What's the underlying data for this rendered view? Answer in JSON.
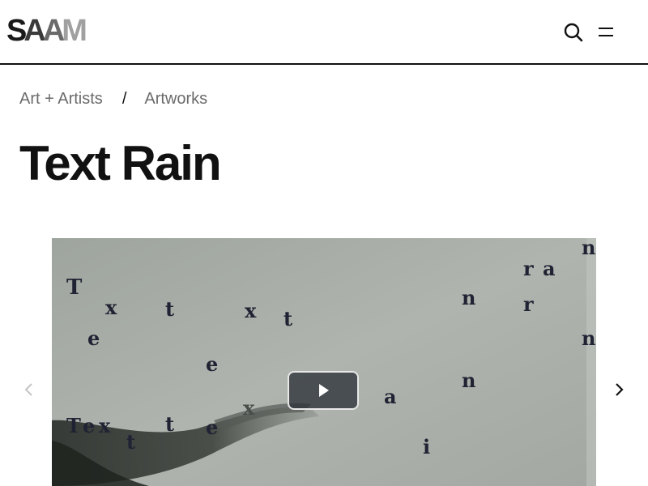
{
  "header": {
    "logo_text": "SAAM",
    "logo_letters": [
      "S",
      "A",
      "A",
      "M"
    ],
    "search_icon": "search-icon",
    "menu_icon": "hamburger-menu-icon"
  },
  "breadcrumb": {
    "items": [
      "Art + Artists",
      "Artworks"
    ],
    "separator": "/"
  },
  "page": {
    "title": "Text Rain"
  },
  "carousel": {
    "prev_icon": "chevron-left-icon",
    "next_icon": "chevron-right-icon",
    "play_icon": "play-icon",
    "video_letters": [
      "T",
      "x",
      "t",
      "x",
      "t",
      "e",
      "e",
      "r",
      "a",
      "n",
      "r",
      "n",
      "n",
      "n",
      "a",
      "i",
      "T",
      "e",
      "x",
      "t",
      "t",
      "e",
      "x"
    ]
  },
  "colors": {
    "text": "#111111",
    "breadcrumb": "#6b6b6b",
    "video_bg": "#a6aba5",
    "letters": "#1f2333",
    "play_bg": "#2d323a"
  }
}
